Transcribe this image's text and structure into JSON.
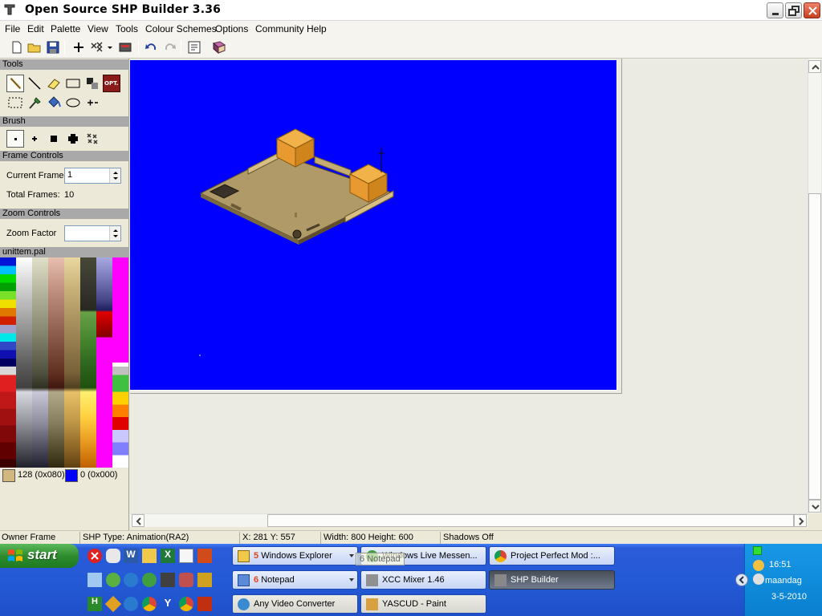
{
  "window": {
    "title": "Open Source SHP Builder 3.36",
    "icon": "shp-builder-app-icon",
    "buttons": [
      "minimize",
      "maximize",
      "close"
    ]
  },
  "menu": [
    "File",
    "Edit",
    "Palette",
    "View",
    "Tools",
    "Colour Schemes",
    "Options",
    "Community",
    "Help"
  ],
  "toolbar": {
    "icons": [
      "new-file-icon",
      "open-folder-icon",
      "save-icon",
      "crosshair-icon",
      "pattern-icon",
      "frame-icon",
      "undo-icon",
      "redo-icon",
      "properties-icon",
      "book-icon"
    ]
  },
  "panels": {
    "tools": {
      "heading": "Tools",
      "items": [
        "pencil-tool",
        "line-tool",
        "eraser-tool",
        "rectangle-tool",
        "darken-lighten-tool",
        "options-tool",
        "select-rect-tool",
        "dropper-tool",
        "fill-tool",
        "ellipse-tool",
        "crosshair-tool"
      ],
      "options_label": "OPT."
    },
    "brush": {
      "heading": "Brush",
      "items": [
        "brush-1",
        "brush-2",
        "brush-3",
        "brush-4",
        "brush-pattern"
      ]
    },
    "frame_controls": {
      "heading": "Frame Controls",
      "current_frame_label": "Current Frame",
      "current_frame_value": "1",
      "total_frames_label": "Total Frames:",
      "total_frames_value": "10"
    },
    "zoom_controls": {
      "heading": "Zoom Controls",
      "zoom_factor_label": "Zoom Factor",
      "zoom_factor_value": ""
    },
    "palette": {
      "name": "unittem.pal",
      "primary_label": "128 (0x080)",
      "primary_color": "#d2b87f",
      "secondary_label": "0 (0x000)",
      "secondary_color": "#0000ff"
    }
  },
  "canvas": {
    "background": "#0000ff"
  },
  "status": {
    "owner_frame": "Owner Frame",
    "shp_type": "SHP Type: Animation(RA2)",
    "coords": "X: 281 Y: 557",
    "size": "Width: 800 Height: 600",
    "shadows": "Shadows Off"
  },
  "taskbar": {
    "start_label": "start",
    "quicklaunch_icons": [
      "close-red-icon",
      "mouse-icon",
      "word-icon",
      "explorer-folder-icon",
      "excel-icon",
      "notepad-icon",
      "powerpoint-icon",
      "network-icon",
      "recycle-icon",
      "media-player-icon",
      "messenger-icon",
      "calculator-icon",
      "paint-icon",
      "ms-office-icon",
      "game-icon",
      "media-icon",
      "chrome-icon",
      "yascud-icon",
      "chrome-alt-icon",
      "fae-icon"
    ],
    "buttons": [
      {
        "count": "5",
        "label": "Windows Explorer",
        "icon": "folder-icon",
        "dropdown": true,
        "state": "normal"
      },
      {
        "count": "",
        "label": "Windows Live Messen...",
        "icon": "messenger-icon",
        "dropdown": false,
        "state": "normal"
      },
      {
        "count": "",
        "label": "Project Perfect Mod :...",
        "icon": "chrome-icon",
        "dropdown": false,
        "state": "normal"
      },
      {
        "count": "6",
        "label": "Notepad",
        "icon": "notepad-icon",
        "dropdown": true,
        "state": "normal"
      },
      {
        "count": "",
        "label": "XCC Mixer 1.46",
        "icon": "xcc-icon",
        "dropdown": false,
        "state": "normal"
      },
      {
        "count": "",
        "label": "SHP Builder",
        "icon": "shp-builder-icon",
        "dropdown": false,
        "state": "active"
      },
      {
        "count": "",
        "label": "Any Video Converter",
        "icon": "video-converter-icon",
        "dropdown": false,
        "state": "dark"
      },
      {
        "count": "",
        "label": "YASCUD - Paint",
        "icon": "paint-icon",
        "dropdown": false,
        "state": "dark"
      }
    ],
    "tooltip": "6 Notepad"
  },
  "tray": {
    "time": "16:51",
    "day": "maandag",
    "date": "3-5-2010"
  }
}
